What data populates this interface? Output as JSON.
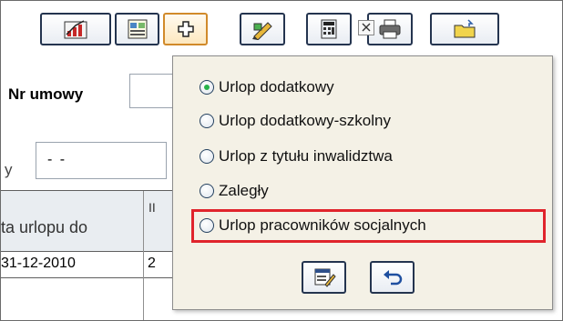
{
  "toolbar": {
    "buttons": [
      {
        "icon": "chart-icon"
      },
      {
        "icon": "form-icon"
      },
      {
        "icon": "add-icon",
        "active": true
      },
      {
        "icon": "edit-pencil-icon"
      },
      {
        "icon": "calculator-icon"
      },
      {
        "icon": "printer-icon"
      },
      {
        "icon": "folder-icon"
      }
    ]
  },
  "form": {
    "nr_umowy_label": "Nr umowy",
    "partial_label": "y",
    "date_value": "- -"
  },
  "table": {
    "header_partial": "ta urlopu do",
    "header_next_partial": "II",
    "rows": [
      {
        "date_partial": "31-12-2010",
        "next_partial": "2"
      }
    ]
  },
  "popup": {
    "close_icon": "close-icon",
    "options": [
      {
        "label": "Urlop dodatkowy",
        "checked": true
      },
      {
        "label": "Urlop dodatkowy-szkolny",
        "checked": false
      },
      {
        "label": "Urlop z tytułu inwalidztwa",
        "checked": false
      },
      {
        "label": "Zaległy",
        "checked": false
      },
      {
        "label": "Urlop pracowników socjalnych",
        "checked": false,
        "highlighted": true
      }
    ],
    "buttons": [
      {
        "icon": "edit-form-icon"
      },
      {
        "icon": "undo-icon"
      }
    ]
  },
  "colors": {
    "highlight": "#e0242c",
    "radio_checked": "#27b34a",
    "popup_bg": "#f4f1e6",
    "button_border": "#24344f"
  }
}
